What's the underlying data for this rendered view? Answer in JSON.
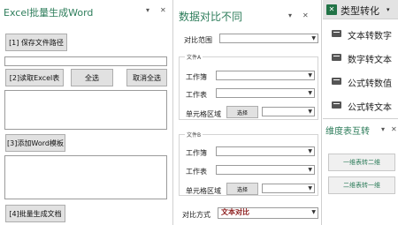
{
  "pane1": {
    "title": "Excel批量生成Word",
    "save_path_button": "[1] 保存文件路径",
    "read_excel_button": "[2]读取Excel表",
    "select_all_button": "全选",
    "deselect_all_button": "取消全选",
    "add_template_button": "[3]添加Word模板",
    "batch_generate_button": "[4]批量生成文档"
  },
  "pane2": {
    "title": "数据对比不同",
    "compare_range_label": "对比范围",
    "file_a": {
      "group_label": "文件A",
      "workbook_label": "工作簿",
      "sheet_label": "工作表",
      "cell_range_label": "单元格区域",
      "select_button": "选择"
    },
    "file_b": {
      "group_label": "文件B",
      "workbook_label": "工作簿",
      "sheet_label": "工作表",
      "cell_range_label": "单元格区域",
      "select_button": "选择"
    },
    "compare_mode_label": "对比方式",
    "compare_mode_value": "文本对比"
  },
  "pane3": {
    "header_icon": "close-x-icon",
    "title": "类型转化",
    "menu_items": [
      "文本转数字",
      "数字转文本",
      "公式转数值",
      "公式转文本"
    ]
  },
  "pane4": {
    "title": "维度表互转",
    "one_to_two_button": "一维表转二维",
    "two_to_one_button": "二维表转一维"
  },
  "colors": {
    "accent_green": "#2e7d5b",
    "header_green": "#217346",
    "compare_value_red": "#8b1a1a"
  }
}
